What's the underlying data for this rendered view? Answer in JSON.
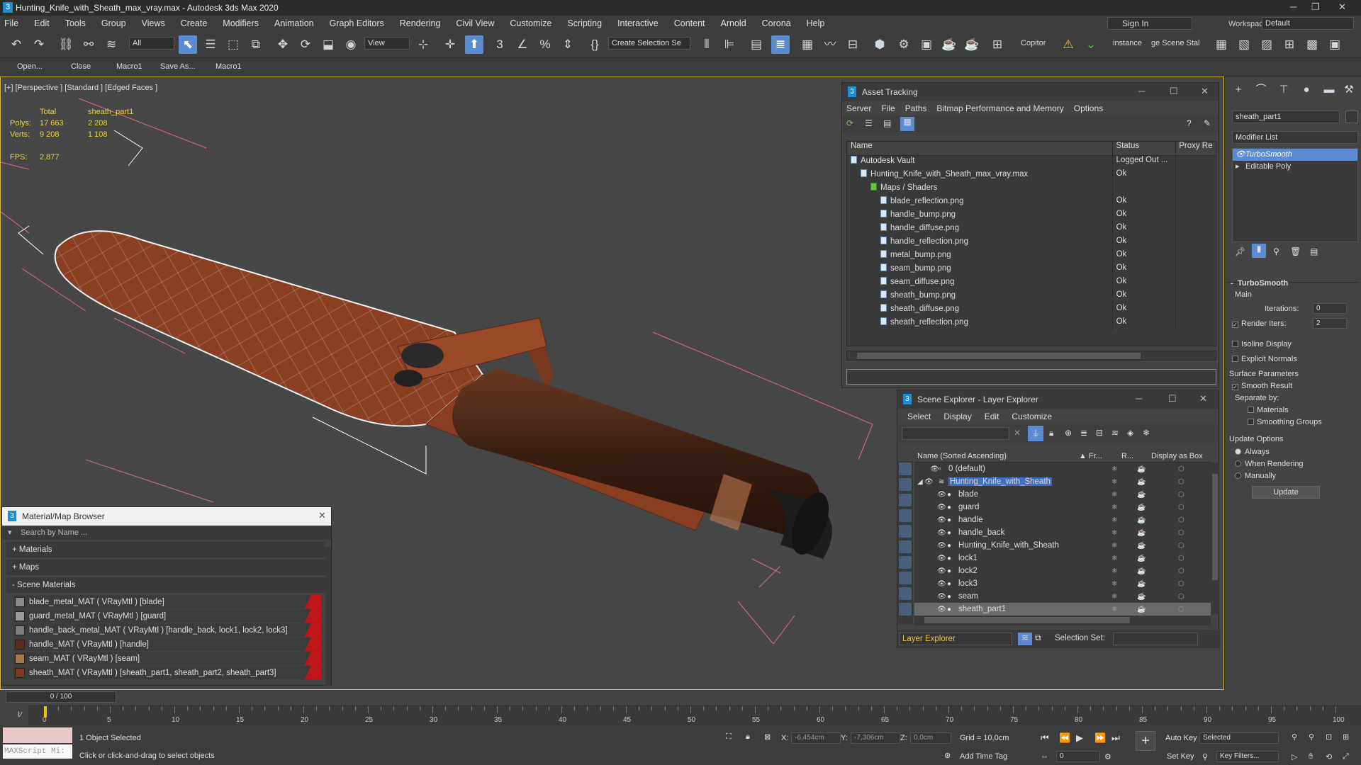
{
  "window": {
    "title": "Hunting_Knife_with_Sheath_max_vray.max - Autodesk 3ds Max 2020",
    "app_letter": "3"
  },
  "menu": [
    "File",
    "Edit",
    "Tools",
    "Group",
    "Views",
    "Create",
    "Modifiers",
    "Animation",
    "Graph Editors",
    "Rendering",
    "Civil View",
    "Customize",
    "Scripting",
    "Interactive",
    "Content",
    "Arnold",
    "Corona",
    "Help"
  ],
  "account": {
    "sign_in": "Sign In",
    "workspaces_label": "Workspaces:",
    "workspace": "Default"
  },
  "toolbar": {
    "filter": "All",
    "view": "View",
    "selection_set": "Create Selection Se",
    "copitor": "Copitor",
    "instance": "instance",
    "scene_state": "ge Scene Stal"
  },
  "toolbar2": {
    "open": "Open...",
    "close": "Close",
    "macro1": "Macro1",
    "save_as": "Save As...",
    "macro1b": "Macro1"
  },
  "viewport": {
    "label": "[+] [Perspective ] [Standard ] [Edged Faces ]",
    "stats": {
      "total_label": "Total",
      "object_label": "sheath_part1",
      "polys_label": "Polys:",
      "polys_total": "17 663",
      "polys_obj": "2 208",
      "verts_label": "Verts:",
      "verts_total": "9 208",
      "verts_obj": "1 108",
      "fps_label": "FPS:",
      "fps": "2,877"
    }
  },
  "asset_tracking": {
    "title": "Asset Tracking",
    "menu": [
      "Server",
      "File",
      "Paths",
      "Bitmap Performance and Memory",
      "Options"
    ],
    "columns": [
      "Name",
      "Status",
      "Proxy Re"
    ],
    "rows": [
      {
        "name": "Autodesk Vault",
        "status": "Logged Out ...",
        "indent": 0
      },
      {
        "name": "Hunting_Knife_with_Sheath_max_vray.max",
        "status": "Ok",
        "indent": 1
      },
      {
        "name": "Maps / Shaders",
        "status": "",
        "indent": 2
      },
      {
        "name": "blade_reflection.png",
        "status": "Ok",
        "indent": 3
      },
      {
        "name": "handle_bump.png",
        "status": "Ok",
        "indent": 3
      },
      {
        "name": "handle_diffuse.png",
        "status": "Ok",
        "indent": 3
      },
      {
        "name": "handle_reflection.png",
        "status": "Ok",
        "indent": 3
      },
      {
        "name": "metal_bump.png",
        "status": "Ok",
        "indent": 3
      },
      {
        "name": "seam_bump.png",
        "status": "Ok",
        "indent": 3
      },
      {
        "name": "seam_diffuse.png",
        "status": "Ok",
        "indent": 3
      },
      {
        "name": "sheath_bump.png",
        "status": "Ok",
        "indent": 3
      },
      {
        "name": "sheath_diffuse.png",
        "status": "Ok",
        "indent": 3
      },
      {
        "name": "sheath_reflection.png",
        "status": "Ok",
        "indent": 3
      }
    ]
  },
  "scene_explorer": {
    "title": "Scene Explorer - Layer Explorer",
    "menu": [
      "Select",
      "Display",
      "Edit",
      "Customize"
    ],
    "columns": {
      "name": "Name (Sorted Ascending)",
      "fr": "Fr...",
      "r": "R...",
      "box": "Display as Box"
    },
    "rows": [
      {
        "name": "0 (default)",
        "level": 0,
        "selected": false
      },
      {
        "name": "Hunting_Knife_with_Sheath",
        "level": 0,
        "selected": false,
        "highlight": true
      },
      {
        "name": "blade",
        "level": 1,
        "selected": false
      },
      {
        "name": "guard",
        "level": 1,
        "selected": false
      },
      {
        "name": "handle",
        "level": 1,
        "selected": false
      },
      {
        "name": "handle_back",
        "level": 1,
        "selected": false
      },
      {
        "name": "Hunting_Knife_with_Sheath",
        "level": 1,
        "selected": false
      },
      {
        "name": "lock1",
        "level": 1,
        "selected": false
      },
      {
        "name": "lock2",
        "level": 1,
        "selected": false
      },
      {
        "name": "lock3",
        "level": 1,
        "selected": false
      },
      {
        "name": "seam",
        "level": 1,
        "selected": false
      },
      {
        "name": "sheath_part1",
        "level": 1,
        "selected": true
      }
    ],
    "footer": {
      "explorer": "Layer Explorer",
      "selection_set_label": "Selection Set:"
    }
  },
  "material_browser": {
    "title": "Material/Map Browser",
    "search_placeholder": "Search by Name ...",
    "groups": [
      "+ Materials",
      "+ Maps",
      "- Scene Materials"
    ],
    "materials": [
      {
        "label": "blade_metal_MAT  ( VRayMtl )  [blade]",
        "swatch": "#8a8a8a"
      },
      {
        "label": "guard_metal_MAT  ( VRayMtl )  [guard]",
        "swatch": "#9a9a9a"
      },
      {
        "label": "handle_back_metal_MAT  ( VRayMtl )  [handle_back, lock1, lock2, lock3]",
        "swatch": "#7d7d7d"
      },
      {
        "label": "handle_MAT  ( VRayMtl )  [handle]",
        "swatch": "#5a2e1c"
      },
      {
        "label": "seam_MAT  ( VRayMtl )  [seam]",
        "swatch": "#a47a4a"
      },
      {
        "label": "sheath_MAT  ( VRayMtl )  [sheath_part1, sheath_part2, sheath_part3]",
        "swatch": "#7a3d22"
      }
    ]
  },
  "command_panel": {
    "object_name": "sheath_part1",
    "modifier_list": "Modifier List",
    "stack": [
      {
        "name": "TurboSmooth",
        "active": true
      },
      {
        "name": "Editable Poly",
        "active": false
      }
    ],
    "rollout_title": "TurboSmooth",
    "main_label": "Main",
    "iterations_label": "Iterations:",
    "iterations": "0",
    "render_iters_label": "Render Iters:",
    "render_iters": "2",
    "isoline": "Isoline Display",
    "explicit_normals": "Explicit Normals",
    "surface_params": "Surface Parameters",
    "smooth_result": "Smooth Result",
    "separate_by": "Separate by:",
    "materials": "Materials",
    "smoothing_groups": "Smoothing Groups",
    "update_options": "Update Options",
    "always": "Always",
    "when_rendering": "When Rendering",
    "manually": "Manually",
    "update_btn": "Update"
  },
  "timeline": {
    "frame": "0 / 100",
    "ticks": [
      "0",
      "5",
      "10",
      "15",
      "20",
      "25",
      "30",
      "35",
      "40",
      "45",
      "50",
      "55",
      "60",
      "65",
      "70",
      "75",
      "80",
      "85",
      "90",
      "95",
      "100"
    ]
  },
  "status": {
    "maxscript": "MAXScript Mi:",
    "selected": "1 Object Selected",
    "prompt": "Click or click-and-drag to select objects",
    "x_label": "X:",
    "x": "-6,454cm",
    "y_label": "Y:",
    "y": "-7,306cm",
    "z_label": "Z:",
    "z": "0,0cm",
    "grid": "Grid = 10,0cm",
    "add_time_tag": "Add Time Tag",
    "auto_key": "Auto Key",
    "set_key": "Set Key",
    "selected_dd": "Selected",
    "key_filters": "Key Filters...",
    "frame_field": "0"
  }
}
